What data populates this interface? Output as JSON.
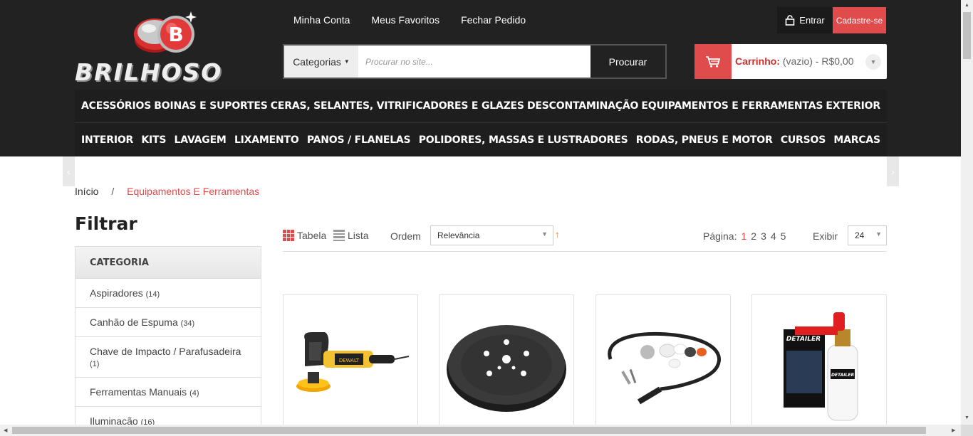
{
  "brand": {
    "name": "BRILHOSO",
    "logo_letter": "B"
  },
  "top_links": [
    "Minha Conta",
    "Meus Favoritos",
    "Fechar Pedido"
  ],
  "auth": {
    "login": "Entrar",
    "signup": "Cadastre-se"
  },
  "search": {
    "category_label": "Categorias",
    "placeholder": "Procurar no site...",
    "button": "Procurar"
  },
  "cart": {
    "label": "Carrinho:",
    "status": "(vazio) - R$0,00"
  },
  "nav_row1": [
    "ACESSÓRIOS",
    "BOINAS E SUPORTES",
    "CERAS, SELANTES, VITRIFICADORES E GLAZES",
    "DESCONTAMINAÇÃO",
    "EQUIPAMENTOS E FERRAMENTAS",
    "EXTERIOR"
  ],
  "nav_row2": [
    "INTERIOR",
    "KITS",
    "LAVAGEM",
    "LIXAMENTO",
    "PANOS / FLANELAS",
    "POLIDORES, MASSAS E LUSTRADORES",
    "RODAS, PNEUS E MOTOR",
    "CURSOS",
    "MARCAS"
  ],
  "breadcrumb": {
    "home": "Início",
    "separator": "/",
    "current": "Equipamentos E Ferramentas"
  },
  "filter": {
    "title": "Filtrar",
    "heading": "CATEGORIA",
    "items": [
      {
        "label": "Aspiradores",
        "count": "(14)"
      },
      {
        "label": "Canhão de Espuma",
        "count": "(34)"
      },
      {
        "label": "Chave de Impacto / Parafusadeira",
        "count": "(1)"
      },
      {
        "label": "Ferramentas Manuais",
        "count": "(4)"
      },
      {
        "label": "Iluminação",
        "count": "(16)"
      }
    ]
  },
  "toolbar": {
    "view_table": "Tabela",
    "view_list": "Lista",
    "order_label": "Ordem",
    "order_value": "Relevância",
    "page_label": "Página:",
    "pages": [
      "1",
      "2",
      "3",
      "4",
      "5"
    ],
    "show_label": "Exibir",
    "show_value": "24"
  },
  "products": [
    {
      "image": "polisher-machine-icon"
    },
    {
      "image": "backing-pad-icon"
    },
    {
      "image": "flexible-shaft-kit-icon"
    },
    {
      "image": "foam-cannon-icon"
    }
  ],
  "detailer_label": "DETAILER",
  "colors": {
    "accent": "#e04b4b",
    "header_bg": "#222222",
    "nav_bg": "#1e1e1e"
  }
}
